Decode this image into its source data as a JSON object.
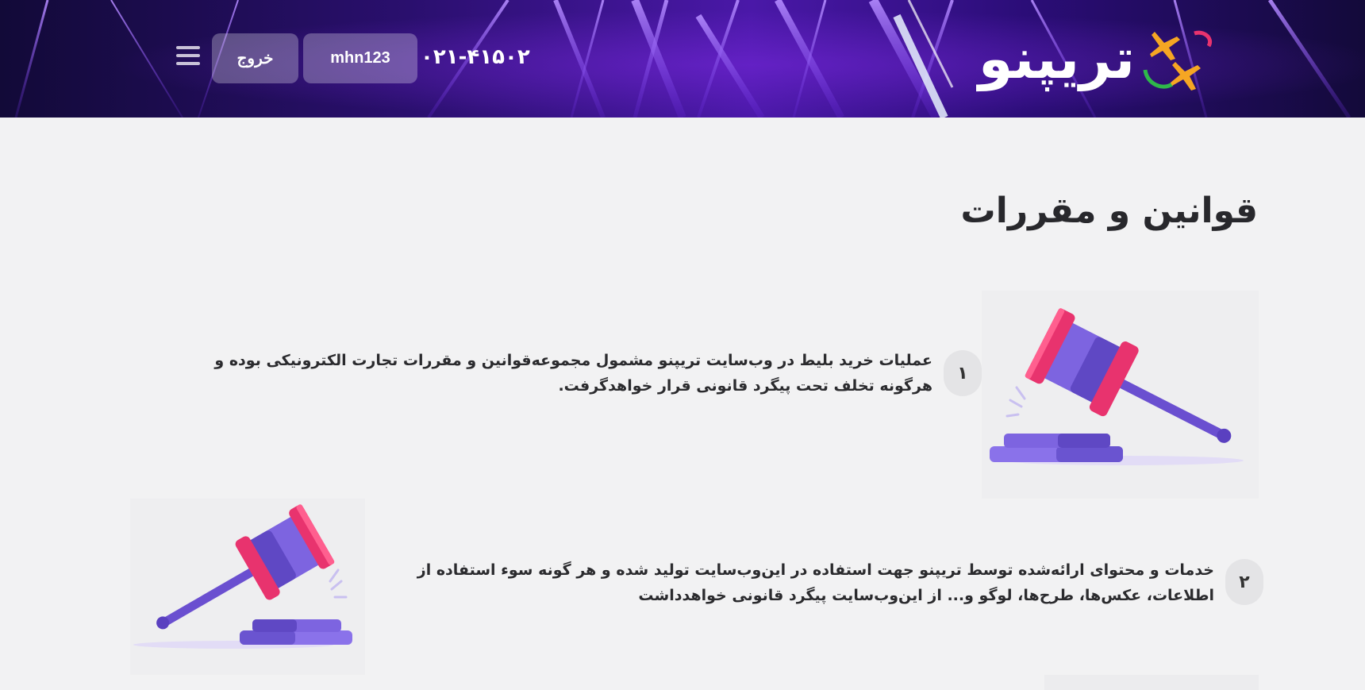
{
  "header": {
    "brand_name": "تریپنو",
    "phone": "۰۲۱-۴۱۵۰۲",
    "user_label": "mhn123",
    "logout_label": "خروج",
    "colors": {
      "bg_dark": "#120a38",
      "bg_accent": "#4a18a8",
      "button_bg": "rgba(255,255,255,0.28)"
    },
    "icons": {
      "logo": "plane-logo-icon",
      "menu": "hamburger-menu-icon"
    }
  },
  "main": {
    "title": "قوانین و مقررات",
    "rules": [
      {
        "number": "۱",
        "text": "عملیات خرید بلیط در وب‌سایت تریپنو مشمول مجموعه‌قوانین و مقررات تجارت الکترونیکی بوده و هرگونه تخلف تحت پیگرد قانونی قرار خواهدگرفت.",
        "image_icon": "gavel-icon"
      },
      {
        "number": "۲",
        "text": "خدمات و محتوای ارائه‌شده توسط تریپنو جهت استفاده در این‌وب‌سایت تولید شده و هر گونه سوء استفاده از اطلاعات، عکس‌ها، طرح‌ها، لوگو و... از این‌وب‌سایت پیگرد قانونی خواهدداشت",
        "image_icon": "gavel-icon"
      }
    ],
    "colors": {
      "gavel_head": "#7d64e0",
      "gavel_band": "#e8336e",
      "gavel_handle": "#6a4fd0"
    }
  }
}
